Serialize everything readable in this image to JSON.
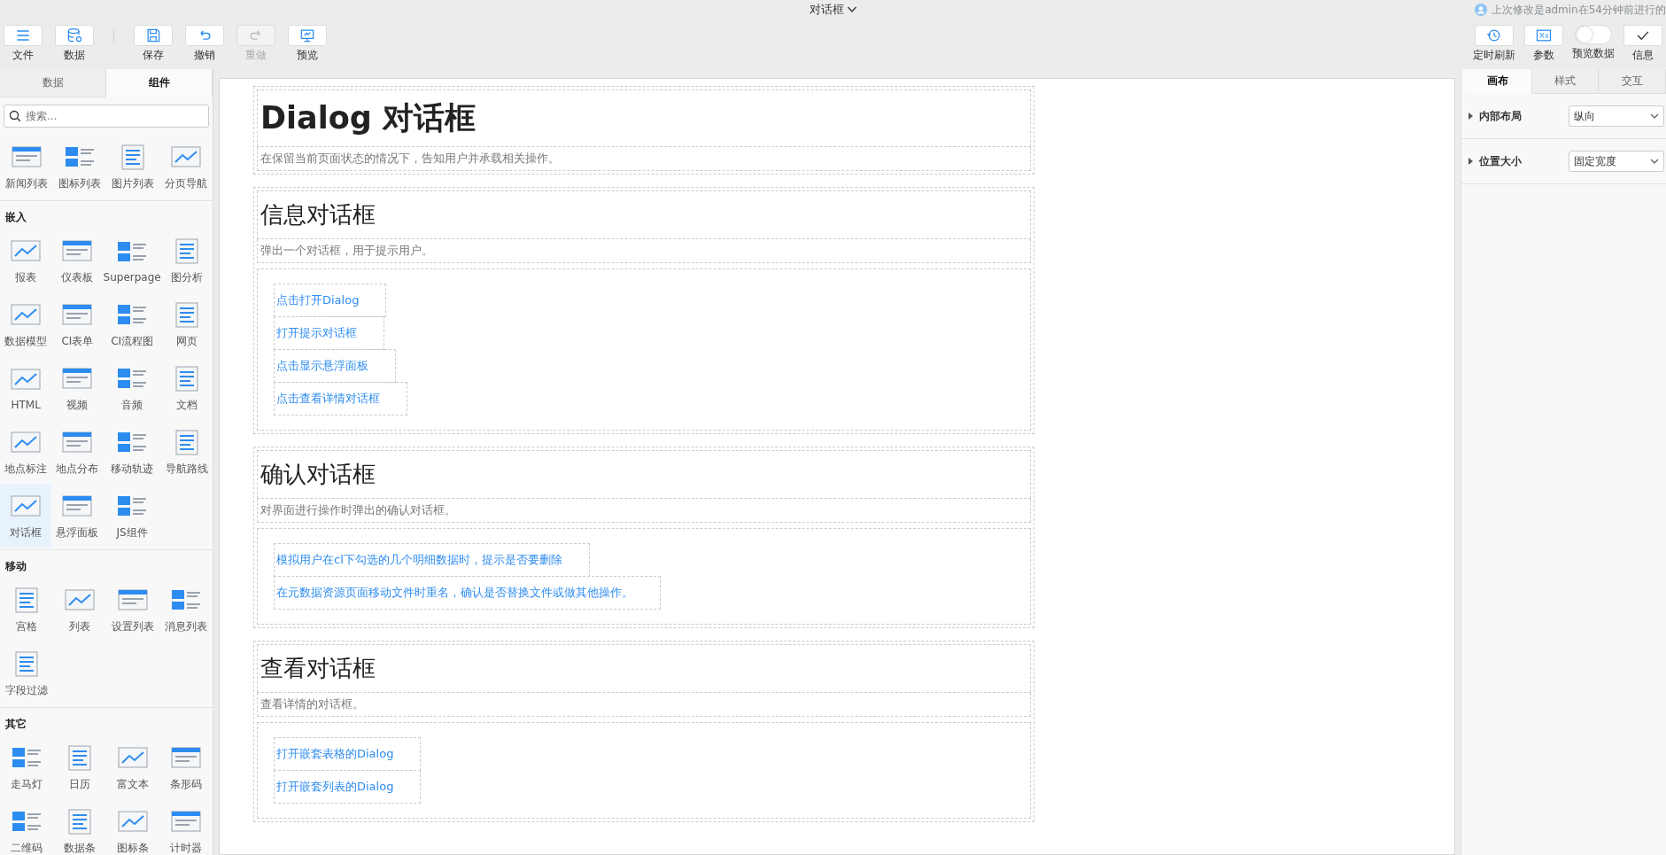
{
  "title": "对话框",
  "last_modified": "上次修改是admin在54分钟前进行的",
  "toolbar_left": [
    {
      "label": "文件",
      "disabled": false
    },
    {
      "label": "数据",
      "disabled": false
    },
    {
      "label": "保存",
      "disabled": false
    },
    {
      "label": "撤销",
      "disabled": false
    },
    {
      "label": "重做",
      "disabled": true
    },
    {
      "label": "预览",
      "disabled": false
    }
  ],
  "toolbar_right": [
    {
      "label": "定时刷新",
      "kind": "button"
    },
    {
      "label": "参数",
      "kind": "button"
    },
    {
      "label": "预览数据",
      "kind": "toggle",
      "on": false
    },
    {
      "label": "信息",
      "kind": "button"
    }
  ],
  "sidebar": {
    "tabs": [
      {
        "label": "数据",
        "selected": false
      },
      {
        "label": "组件",
        "selected": true
      }
    ],
    "search": {
      "placeholder": "搜索..."
    },
    "groups": [
      {
        "items": [
          {
            "label": "新闻列表",
            "selected": false
          },
          {
            "label": "图标列表",
            "selected": false
          },
          {
            "label": "图片列表",
            "selected": false
          },
          {
            "label": "分页导航",
            "selected": false
          }
        ]
      },
      {
        "title": "嵌入",
        "items": [
          {
            "label": "报表",
            "selected": false
          },
          {
            "label": "仪表板",
            "selected": false
          },
          {
            "label": "Superpage",
            "selected": false
          },
          {
            "label": "图分析",
            "selected": false
          },
          {
            "label": "数据模型",
            "selected": false
          },
          {
            "label": "CI表单",
            "selected": false
          },
          {
            "label": "CI流程图",
            "selected": false
          },
          {
            "label": "网页",
            "selected": false
          },
          {
            "label": "HTML",
            "selected": false
          },
          {
            "label": "视频",
            "selected": false
          },
          {
            "label": "音频",
            "selected": false
          },
          {
            "label": "文档",
            "selected": false
          },
          {
            "label": "地点标注",
            "selected": false
          },
          {
            "label": "地点分布",
            "selected": false
          },
          {
            "label": "移动轨迹",
            "selected": false
          },
          {
            "label": "导航路线",
            "selected": false
          },
          {
            "label": "对话框",
            "selected": true
          },
          {
            "label": "悬浮面板",
            "selected": false
          },
          {
            "label": "JS组件",
            "selected": false
          }
        ]
      },
      {
        "title": "移动",
        "items": [
          {
            "label": "宫格",
            "selected": false
          },
          {
            "label": "列表",
            "selected": false
          },
          {
            "label": "设置列表",
            "selected": false
          },
          {
            "label": "消息列表",
            "selected": false
          },
          {
            "label": "字段过滤",
            "selected": false
          }
        ]
      },
      {
        "title": "其它",
        "items": [
          {
            "label": "走马灯",
            "selected": false
          },
          {
            "label": "日历",
            "selected": false
          },
          {
            "label": "富文本",
            "selected": false
          },
          {
            "label": "条形码",
            "selected": false
          },
          {
            "label": "二维码",
            "selected": false
          },
          {
            "label": "数据条",
            "selected": false
          },
          {
            "label": "图标条",
            "selected": false
          },
          {
            "label": "计时器",
            "selected": false
          }
        ]
      }
    ]
  },
  "canvas": {
    "sections": [
      {
        "kind": "header",
        "title": "Dialog 对话框",
        "description": "在保留当前页面状态的情况下，告知用户并承载相关操作。"
      },
      {
        "kind": "demo",
        "title": "信息对话框",
        "description": "弹出一个对话框，用于提示用户。",
        "links": [
          "点击打开Dialog",
          "打开提示对话框",
          "点击显示悬浮面板",
          "点击查看详情对话框"
        ]
      },
      {
        "kind": "demo",
        "title": "确认对话框",
        "description": "对界面进行操作时弹出的确认对话框。",
        "links": [
          "模拟用户在cl下勾选的几个明细数据时，提示是否要删除",
          "在元数据资源页面移动文件时重名，确认是否替换文件或做其他操作。"
        ]
      },
      {
        "kind": "demo",
        "title": "查看对话框",
        "description": "查看详情的对话框。",
        "links": [
          "打开嵌套表格的Dialog",
          "打开嵌套列表的Dialog"
        ]
      }
    ]
  },
  "properties": {
    "tabs": [
      {
        "label": "画布",
        "selected": true
      },
      {
        "label": "样式",
        "selected": false
      },
      {
        "label": "交互",
        "selected": false
      }
    ],
    "rows": [
      {
        "label": "内部布局",
        "value": "纵向"
      },
      {
        "label": "位置大小",
        "value": "固定宽度"
      }
    ]
  }
}
